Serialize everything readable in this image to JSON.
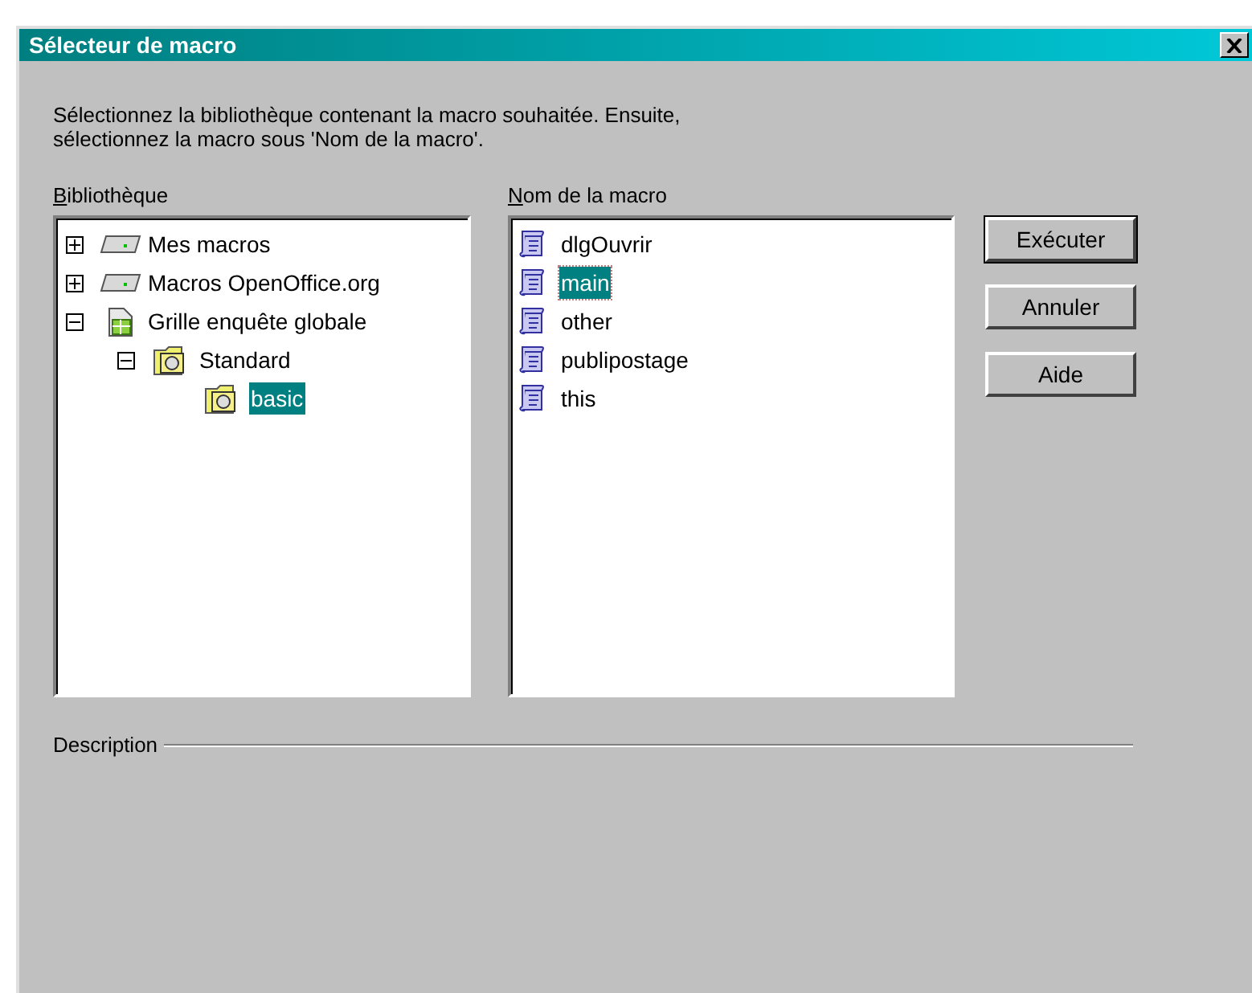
{
  "window": {
    "title": "Sélecteur de macro"
  },
  "instructions": "Sélectionnez la bibliothèque contenant la macro souhaitée. Ensuite,\nsélectionnez la macro sous 'Nom de la macro'.",
  "library": {
    "label": "Bibliothèque",
    "items": [
      {
        "label": "Mes macros",
        "kind": "drive",
        "expanded": false,
        "selected": false
      },
      {
        "label": "Macros OpenOffice.org",
        "kind": "drive",
        "expanded": false,
        "selected": false
      },
      {
        "label": "Grille enquête globale",
        "kind": "document",
        "expanded": true,
        "selected": false,
        "children": [
          {
            "label": "Standard",
            "kind": "library",
            "expanded": true,
            "selected": false,
            "children": [
              {
                "label": "basic",
                "kind": "module",
                "selected": true
              }
            ]
          }
        ]
      }
    ]
  },
  "macros": {
    "label": "Nom de la macro",
    "items": [
      {
        "label": "dlgOuvrir",
        "selected": false
      },
      {
        "label": "main",
        "selected": true
      },
      {
        "label": "other",
        "selected": false
      },
      {
        "label": "publipostage",
        "selected": false
      },
      {
        "label": "this",
        "selected": false
      }
    ]
  },
  "buttons": [
    {
      "label": "Exécuter",
      "default": true
    },
    {
      "label": "Annuler",
      "default": false
    },
    {
      "label": "Aide",
      "default": false
    }
  ],
  "description": {
    "label": "Description"
  }
}
